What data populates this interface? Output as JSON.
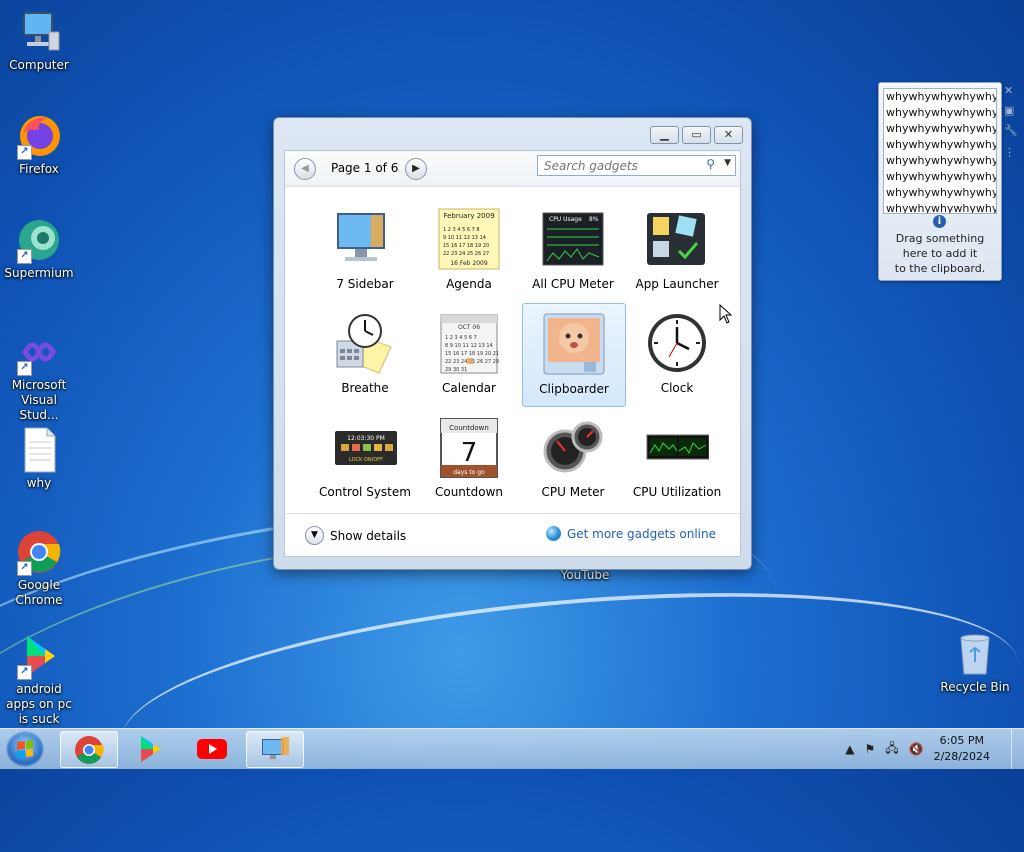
{
  "desktop": {
    "icons": [
      {
        "label": "Computer"
      },
      {
        "label": "Firefox"
      },
      {
        "label": "Supermium"
      },
      {
        "label": "Microsoft Visual Stud..."
      },
      {
        "label": "why"
      },
      {
        "label": "Google Chrome"
      },
      {
        "label": "android apps on pc is suck"
      },
      {
        "label": "YouTube"
      },
      {
        "label": "Recycle Bin"
      }
    ]
  },
  "gadget_window": {
    "page_label": "Page 1 of 6",
    "search_placeholder": "Search gadgets",
    "gadgets": [
      {
        "label": "7 Sidebar"
      },
      {
        "label": "Agenda"
      },
      {
        "label": "All CPU Meter"
      },
      {
        "label": "App Launcher"
      },
      {
        "label": "Breathe"
      },
      {
        "label": "Calendar"
      },
      {
        "label": "Clipboarder"
      },
      {
        "label": "Clock"
      },
      {
        "label": "Control System"
      },
      {
        "label": "Countdown"
      },
      {
        "label": "CPU Meter"
      },
      {
        "label": "CPU Utilization"
      }
    ],
    "show_details": "Show details",
    "get_more": "Get more gadgets online",
    "thumb_text": {
      "agenda_month": "February 2009",
      "agenda_footer": "16 Feb 2009",
      "cpu_usage_title": "CPU Usage",
      "cpu_usage_pct": "8%",
      "calendar_month": "OCT 06",
      "control_time": "12:03:30 PM",
      "control_lock": "LOCK ON/OFF",
      "countdown_title": "Countdown",
      "countdown_num": "7",
      "countdown_sub": "days to go"
    }
  },
  "clipboarder_widget": {
    "lines": [
      "whywhywhywhywhy",
      "whywhywhywhywhy",
      "whywhywhywhywhy",
      "whywhywhywhywhy",
      "whywhywhywhywhy",
      "whywhywhywhywhy",
      "whywhywhywhywhy",
      "whywhywhywhywhy"
    ],
    "message": [
      "Drag something",
      "here to add it",
      "to the clipboard."
    ]
  },
  "taskbar": {
    "time": "6:05 PM",
    "date": "2/28/2024"
  }
}
